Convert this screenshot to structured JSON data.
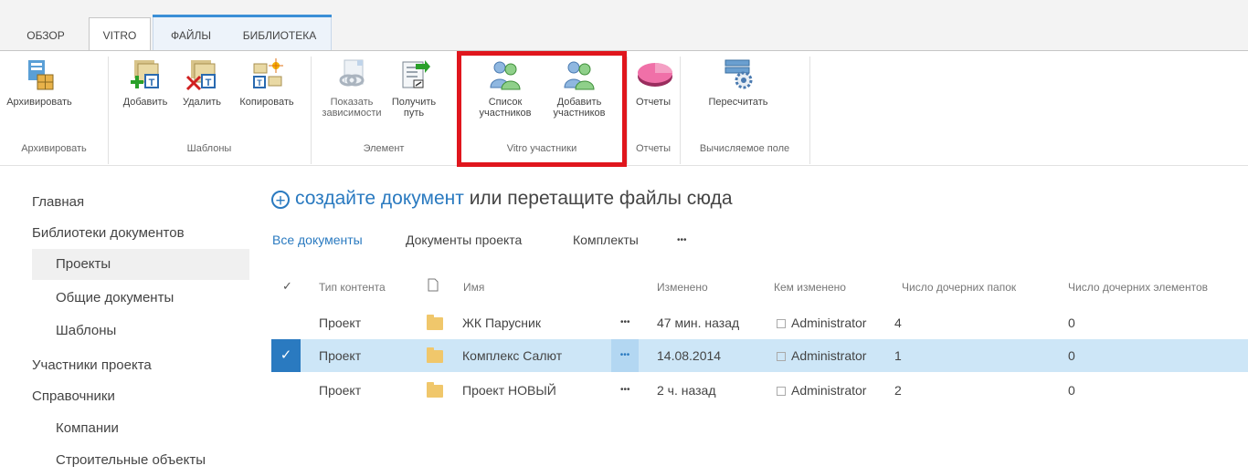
{
  "tabs": [
    {
      "label": "ОБЗОР"
    },
    {
      "label": "VITRO"
    },
    {
      "label": "ФАЙЛЫ"
    },
    {
      "label": "БИБЛИОТЕКА"
    }
  ],
  "ribbon": {
    "buttons": [
      {
        "label": "Архивировать"
      },
      {
        "label": "Добавить"
      },
      {
        "label": "Удалить"
      },
      {
        "label": "Копировать"
      },
      {
        "label": "Показать\nзависимости"
      },
      {
        "label": "Получить\nпуть"
      },
      {
        "label": "Список\nучастников"
      },
      {
        "label": "Добавить\nучастников"
      },
      {
        "label": "Отчеты"
      },
      {
        "label": "Пересчитать"
      }
    ],
    "groups": [
      {
        "label": "Архивировать"
      },
      {
        "label": "Шаблоны"
      },
      {
        "label": "Элемент"
      },
      {
        "label": "Vitro участники"
      },
      {
        "label": "Отчеты"
      },
      {
        "label": "Вычисляемое поле"
      }
    ]
  },
  "nav": {
    "items": [
      {
        "label": "Главная"
      },
      {
        "label": "Библиотеки документов"
      },
      {
        "label": "Проекты"
      },
      {
        "label": "Общие документы"
      },
      {
        "label": "Шаблоны"
      },
      {
        "label": "Участники проекта"
      },
      {
        "label": "Справочники"
      },
      {
        "label": "Компании"
      },
      {
        "label": "Строительные объекты"
      }
    ]
  },
  "main": {
    "new_doc_link": "создайте документ",
    "new_doc_rest": " или перетащите файлы сюда",
    "views": [
      {
        "label": "Все документы"
      },
      {
        "label": "Документы проекта"
      },
      {
        "label": "Комплекты"
      },
      {
        "label": "•••"
      }
    ],
    "columns": {
      "check": "✓",
      "type": "Тип контента",
      "name": "Имя",
      "modified": "Изменено",
      "modified_by": "Кем изменено",
      "subfolders": "Число дочерних папок",
      "subitems": "Число дочерних элементов"
    },
    "rows": [
      {
        "type": "Проект",
        "name": "ЖК Парусник",
        "modified": "47 мин. назад",
        "modified_by": "Administrator",
        "subfolders": "4",
        "subitems": "0"
      },
      {
        "type": "Проект",
        "name": "Комплекс Салют",
        "modified": "14.08.2014",
        "modified_by": "Administrator",
        "subfolders": "1",
        "subitems": "0"
      },
      {
        "type": "Проект",
        "name": "Проект НОВЫЙ",
        "modified": "2 ч. назад",
        "modified_by": "Administrator",
        "subfolders": "2",
        "subitems": "0"
      }
    ],
    "ellipsis": "•••",
    "selected_check": "✓"
  },
  "colors": {
    "accent": "#2a7ac0",
    "highlight_box": "#e0161d",
    "selected_row": "#cde6f7"
  }
}
